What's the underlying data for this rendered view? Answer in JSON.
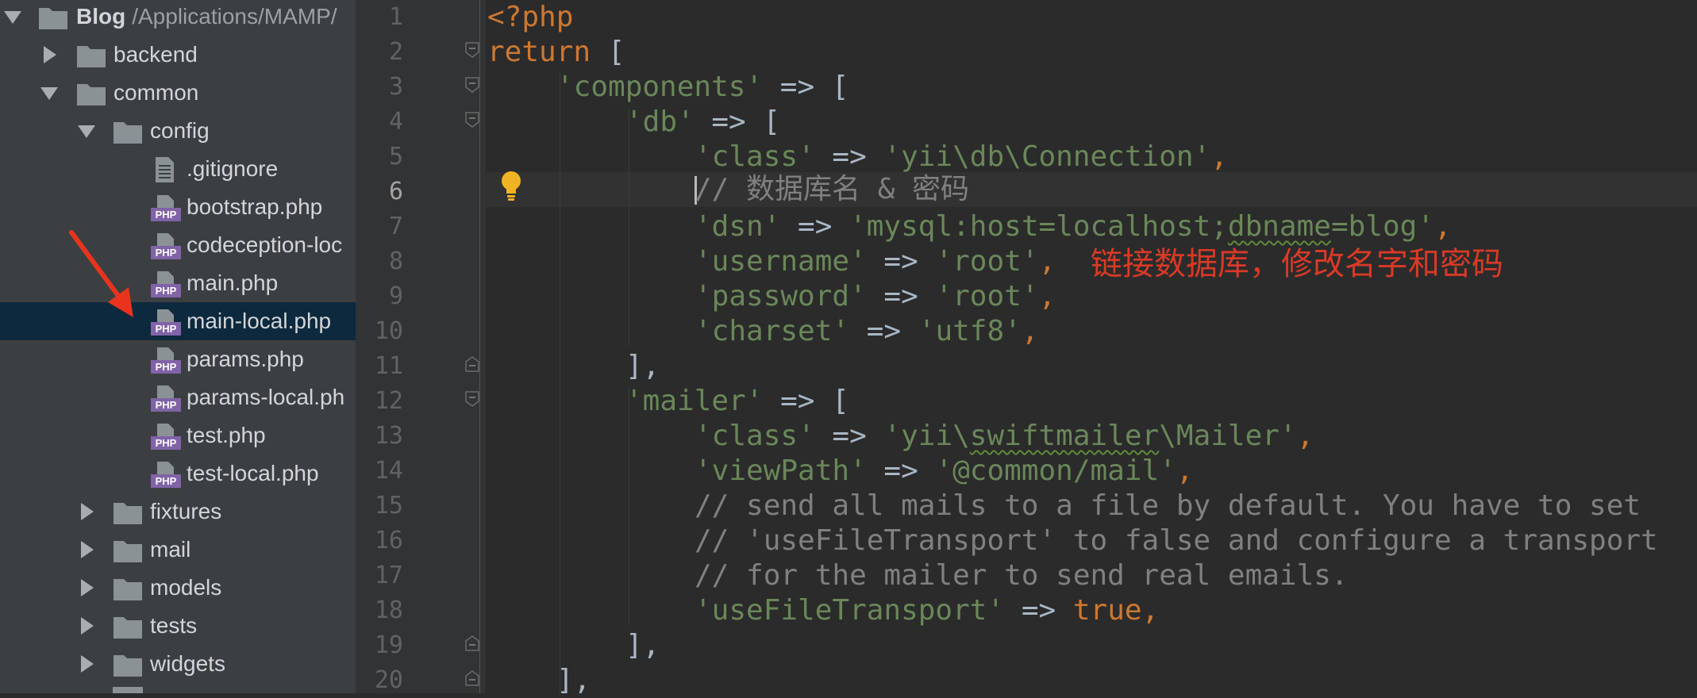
{
  "project_tree": {
    "root": {
      "name": "Blog",
      "path": "/Applications/MAMP/"
    },
    "items": [
      {
        "label": "backend",
        "type": "folder",
        "expanded": false
      },
      {
        "label": "common",
        "type": "folder",
        "expanded": true
      },
      {
        "label": "config",
        "type": "folder",
        "expanded": true
      },
      {
        "label": ".gitignore",
        "type": "text-file"
      },
      {
        "label": "bootstrap.php",
        "type": "php-file"
      },
      {
        "label": "codeception-loc",
        "type": "php-file"
      },
      {
        "label": "main.php",
        "type": "php-file"
      },
      {
        "label": "main-local.php",
        "type": "php-file",
        "selected": true
      },
      {
        "label": "params.php",
        "type": "php-file"
      },
      {
        "label": "params-local.ph",
        "type": "php-file"
      },
      {
        "label": "test.php",
        "type": "php-file"
      },
      {
        "label": "test-local.php",
        "type": "php-file"
      },
      {
        "label": "fixtures",
        "type": "folder",
        "expanded": false
      },
      {
        "label": "mail",
        "type": "folder",
        "expanded": false
      },
      {
        "label": "models",
        "type": "folder",
        "expanded": false
      },
      {
        "label": "tests",
        "type": "folder",
        "expanded": false
      },
      {
        "label": "widgets",
        "type": "folder",
        "expanded": false
      }
    ],
    "php_badge": "PHP"
  },
  "editor": {
    "current_line": 6,
    "line_numbers": [
      "1",
      "2",
      "3",
      "4",
      "5",
      "6",
      "7",
      "8",
      "9",
      "10",
      "11",
      "12",
      "13",
      "14",
      "15",
      "16",
      "17",
      "18",
      "19",
      "20"
    ],
    "code": {
      "l1_open": "<?php",
      "l2_return": "return",
      "l2_bracket": " [",
      "l3_key": "'components'",
      "l3_rest": " => [",
      "l4_key": "'db'",
      "l4_rest": " => [",
      "l5_key": "'class'",
      "l5_arrow": " => ",
      "l5_val": "'yii\\db\\Connection'",
      "l5_end": ",",
      "l6_comment": "// 数据库名 & 密码",
      "l7_key": "'dsn'",
      "l7_arrow": " => ",
      "l7_val_a": "'mysql:host=localhost;",
      "l7_val_b": "dbname",
      "l7_val_c": "=blog'",
      "l7_end": ",",
      "l8_key": "'username'",
      "l8_arrow": " => ",
      "l8_val": "'root'",
      "l8_end": ",",
      "l9_key": "'password'",
      "l9_arrow": " => ",
      "l9_val": "'root'",
      "l9_end": ",",
      "l10_key": "'charset'",
      "l10_arrow": " => ",
      "l10_val": "'utf8'",
      "l10_end": ",",
      "l11_close": "],",
      "l12_key": "'mailer'",
      "l12_rest": " => [",
      "l13_key": "'class'",
      "l13_arrow": " => ",
      "l13_val_a": "'yii\\",
      "l13_val_b": "swiftmailer",
      "l13_val_c": "\\Mailer'",
      "l13_end": ",",
      "l14_key": "'viewPath'",
      "l14_arrow": " => ",
      "l14_val": "'@common/mail'",
      "l14_end": ",",
      "l15_comment": "// send all mails to a file by default. You have to set",
      "l16_comment": "// 'useFileTransport' to false and configure a transport",
      "l17_comment": "// for the mailer to send real emails.",
      "l18_key": "'useFileTransport'",
      "l18_arrow": " => ",
      "l18_val": "true",
      "l18_end": ",",
      "l19_close": "],",
      "l20_close": "],"
    }
  },
  "annotation": {
    "text": "链接数据库，修改名字和密码",
    "color": "#d93a26"
  },
  "colors": {
    "keyword": "#cc7832",
    "string": "#6a8759",
    "comment": "#808080",
    "selection": "#0d293e",
    "annotation_arrow": "#e8341c"
  }
}
